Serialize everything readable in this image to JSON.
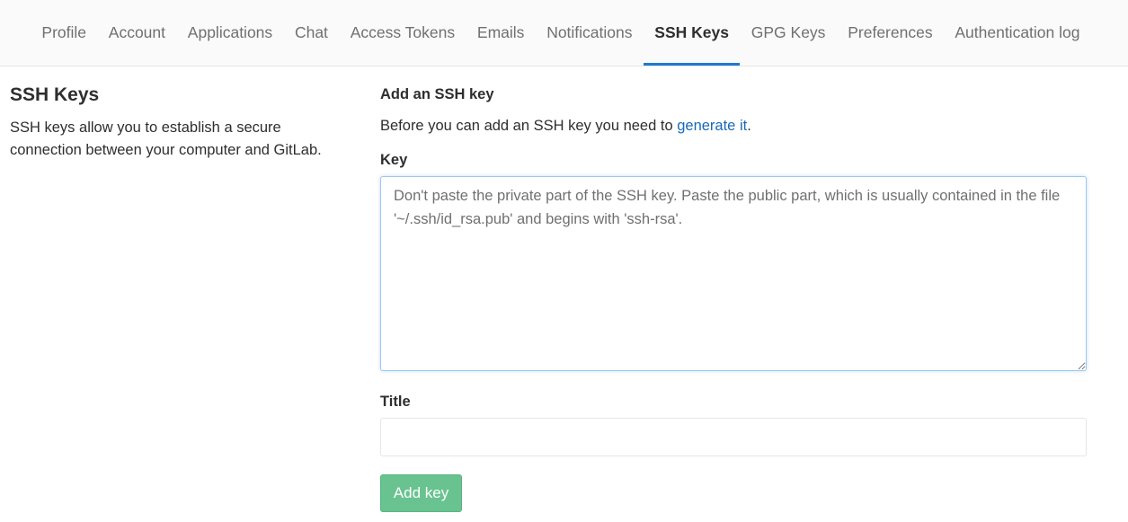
{
  "nav": {
    "tabs": [
      {
        "label": "Profile"
      },
      {
        "label": "Account"
      },
      {
        "label": "Applications"
      },
      {
        "label": "Chat"
      },
      {
        "label": "Access Tokens"
      },
      {
        "label": "Emails"
      },
      {
        "label": "Notifications"
      },
      {
        "label": "SSH Keys"
      },
      {
        "label": "GPG Keys"
      },
      {
        "label": "Preferences"
      },
      {
        "label": "Authentication log"
      }
    ],
    "active_tab": "SSH Keys"
  },
  "sidebar": {
    "title": "SSH Keys",
    "description": "SSH keys allow you to establish a secure connection between your computer and GitLab."
  },
  "form": {
    "heading": "Add an SSH key",
    "intro_text": "Before you can add an SSH key you need to ",
    "intro_link": "generate it",
    "intro_end": ".",
    "key_label": "Key",
    "key_placeholder": "Don't paste the private part of the SSH key. Paste the public part, which is usually contained in the file '~/.ssh/id_rsa.pub' and begins with 'ssh-rsa'.",
    "key_value": "",
    "title_label": "Title",
    "title_value": "",
    "submit_label": "Add key"
  },
  "colors": {
    "accent": "#1f78d1",
    "link": "#1b69b6",
    "button": "#69c390"
  }
}
